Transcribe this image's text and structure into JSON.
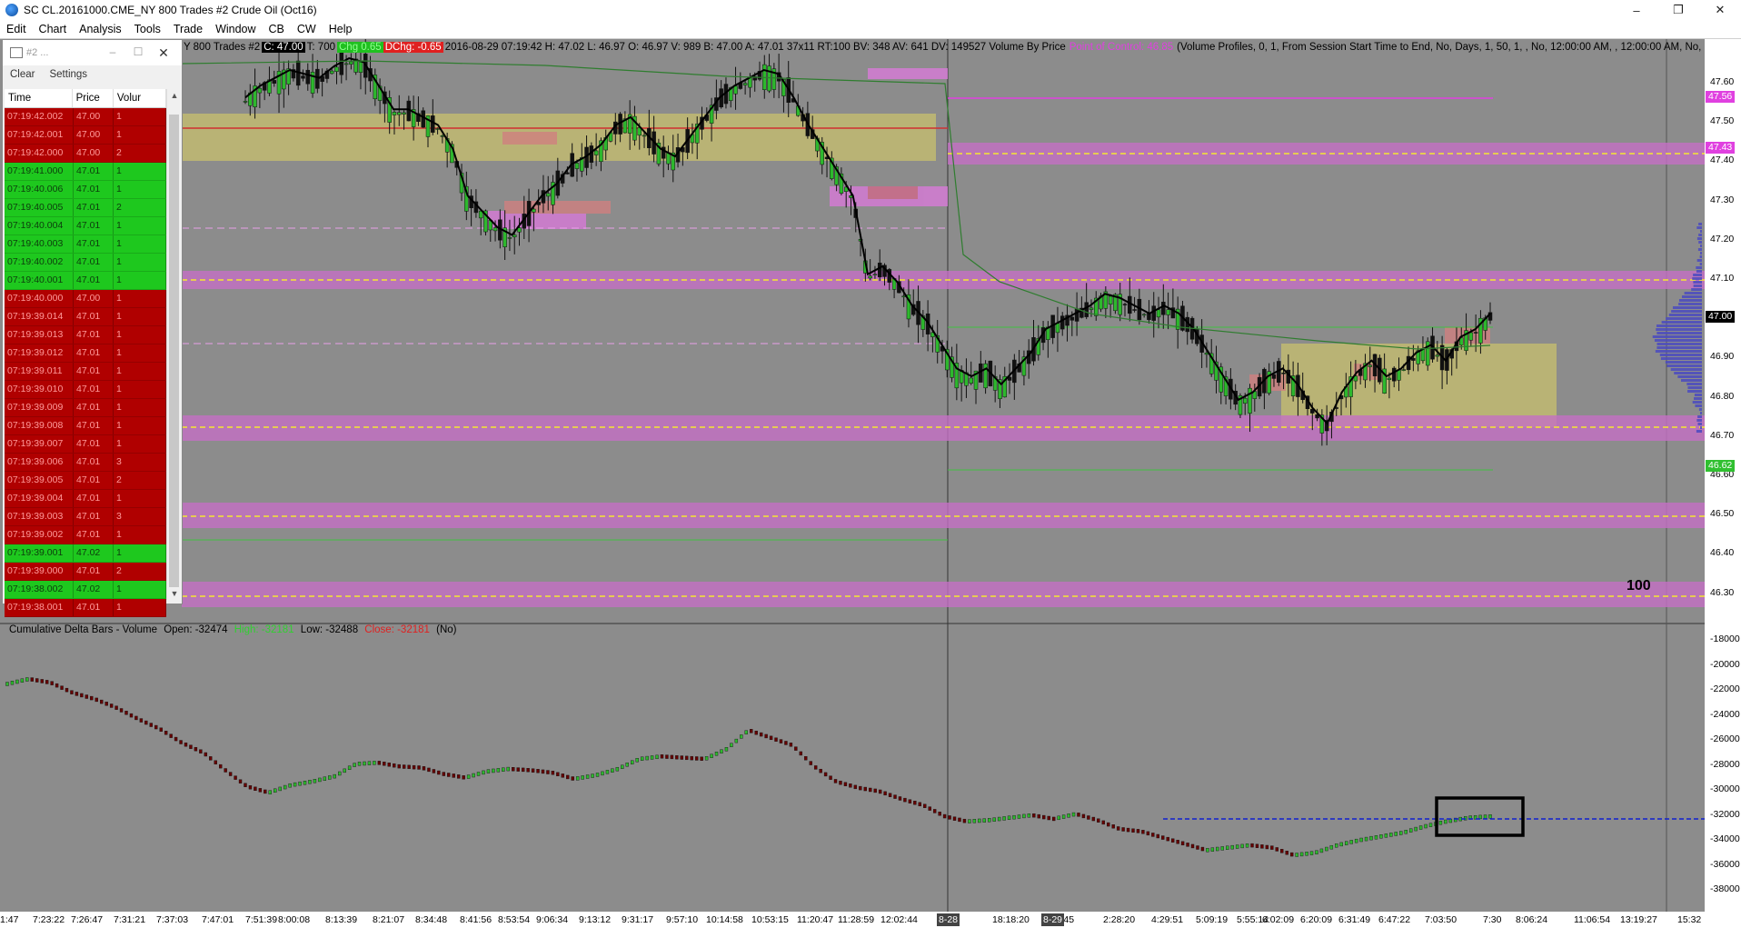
{
  "window": {
    "title": "SC CL.20161000.CME_NY  800 Trades  #2  Crude Oil (Oct16)",
    "controls": [
      "–",
      "❐",
      "✕"
    ]
  },
  "menu": [
    "Edit",
    "Chart",
    "Analysis",
    "Tools",
    "Trade",
    "Window",
    "CB",
    "CW",
    "Help"
  ],
  "chart_info": {
    "prefix": "Y  800 Trades  #2",
    "c_label": "C: 47.00",
    "t_label": "T: 700",
    "chg_label": "Chg 0.65",
    "dchg_label": "DChg: -0.65",
    "ohlc": "2016-08-29 07:19:42 H: 47.02 L: 46.97 O: 46.97 V: 989 B: 47.00 A: 47.01 37x11 RT:100 BV: 348 AV: 641 DV: 149527 Volume By Price",
    "poc": "Point of Control: 46.85",
    "profile": "(Volume Profiles, 0, 1, From Session Start Time to End, No, Days, 1, 50, 1, , No, 12:00:00 AM, , 12:00:00 AM, No, Peri"
  },
  "delta_info": {
    "name": "Cumulative Delta Bars - Volume",
    "open": "Open: -32474",
    "high": "High: -32181",
    "low": "Low: -32488",
    "close": "Close: -32181",
    "extra": "(No)"
  },
  "annotation": "100",
  "ts_panel": {
    "title": "#2 ...",
    "toolbar": [
      "Clear",
      "Settings"
    ],
    "columns": [
      "Time",
      "Price",
      "Volur"
    ],
    "rows": [
      {
        "time": "07:19:42.002",
        "price": "47.00",
        "vol": "1",
        "side": "down"
      },
      {
        "time": "07:19:42.001",
        "price": "47.00",
        "vol": "1",
        "side": "down"
      },
      {
        "time": "07:19:42.000",
        "price": "47.00",
        "vol": "2",
        "side": "down"
      },
      {
        "time": "07:19:41.000",
        "price": "47.01",
        "vol": "1",
        "side": "up"
      },
      {
        "time": "07:19:40.006",
        "price": "47.01",
        "vol": "1",
        "side": "up"
      },
      {
        "time": "07:19:40.005",
        "price": "47.01",
        "vol": "2",
        "side": "up"
      },
      {
        "time": "07:19:40.004",
        "price": "47.01",
        "vol": "1",
        "side": "up"
      },
      {
        "time": "07:19:40.003",
        "price": "47.01",
        "vol": "1",
        "side": "up"
      },
      {
        "time": "07:19:40.002",
        "price": "47.01",
        "vol": "1",
        "side": "up"
      },
      {
        "time": "07:19:40.001",
        "price": "47.01",
        "vol": "1",
        "side": "up"
      },
      {
        "time": "07:19:40.000",
        "price": "47.00",
        "vol": "1",
        "side": "down"
      },
      {
        "time": "07:19:39.014",
        "price": "47.01",
        "vol": "1",
        "side": "down"
      },
      {
        "time": "07:19:39.013",
        "price": "47.01",
        "vol": "1",
        "side": "down"
      },
      {
        "time": "07:19:39.012",
        "price": "47.01",
        "vol": "1",
        "side": "down"
      },
      {
        "time": "07:19:39.011",
        "price": "47.01",
        "vol": "1",
        "side": "down"
      },
      {
        "time": "07:19:39.010",
        "price": "47.01",
        "vol": "1",
        "side": "down"
      },
      {
        "time": "07:19:39.009",
        "price": "47.01",
        "vol": "1",
        "side": "down"
      },
      {
        "time": "07:19:39.008",
        "price": "47.01",
        "vol": "1",
        "side": "down"
      },
      {
        "time": "07:19:39.007",
        "price": "47.01",
        "vol": "1",
        "side": "down"
      },
      {
        "time": "07:19:39.006",
        "price": "47.01",
        "vol": "3",
        "side": "down"
      },
      {
        "time": "07:19:39.005",
        "price": "47.01",
        "vol": "2",
        "side": "down"
      },
      {
        "time": "07:19:39.004",
        "price": "47.01",
        "vol": "1",
        "side": "down"
      },
      {
        "time": "07:19:39.003",
        "price": "47.01",
        "vol": "3",
        "side": "down"
      },
      {
        "time": "07:19:39.002",
        "price": "47.01",
        "vol": "1",
        "side": "down"
      },
      {
        "time": "07:19:39.001",
        "price": "47.02",
        "vol": "1",
        "side": "up"
      },
      {
        "time": "07:19:39.000",
        "price": "47.01",
        "vol": "2",
        "side": "down"
      },
      {
        "time": "07:19:38.002",
        "price": "47.02",
        "vol": "1",
        "side": "up"
      },
      {
        "time": "07:19:38.001",
        "price": "47.01",
        "vol": "1",
        "side": "down"
      }
    ]
  },
  "price_axis": {
    "ticks": [
      "47.60",
      "47.50",
      "47.40",
      "47.30",
      "47.20",
      "47.10",
      "47.00",
      "46.90",
      "46.80",
      "46.70",
      "46.60",
      "46.50",
      "46.40",
      "46.30"
    ],
    "tags": [
      {
        "label": "47.56",
        "color": "#e040e0",
        "text_color": "#fff"
      },
      {
        "label": "47.43",
        "color": "#e040e0",
        "text_color": "#fff"
      },
      {
        "label": "47.00",
        "color": "#000",
        "text_color": "#fff"
      },
      {
        "label": "46.62",
        "color": "#30c030",
        "text_color": "#fff"
      }
    ]
  },
  "delta_axis": {
    "ticks": [
      "-18000",
      "-20000",
      "-22000",
      "-24000",
      "-26000",
      "-28000",
      "-30000",
      "-32000",
      "-34000",
      "-36000",
      "-38000"
    ]
  },
  "time_axis": {
    "labels": [
      "1:47",
      "7:23:22",
      "7:26:47",
      "7:31:21",
      "7:37:03",
      "7:47:01",
      "7:51:39",
      "8:00:08",
      "8:13:39",
      "8:21:07",
      "8:34:48",
      "8:41:56",
      "8:53:54",
      "9:06:34",
      "9:13:12",
      "9:31:17",
      "9:57:10",
      "10:14:58",
      "10:53:15",
      "11:20:47",
      "11:28:59",
      "12:02:44",
      "18:18:20",
      "1:04:45",
      "2:28:20",
      "4:29:51",
      "5:09:19",
      "5:55:14",
      "6:02:09",
      "6:20:09",
      "6:31:49",
      "6:47:22",
      "7:03:50",
      "7:30",
      "8:06:24",
      "11:06:54",
      "13:19:27",
      "15:32"
    ],
    "tags": [
      "8-28",
      "8-29"
    ]
  },
  "chart_data": {
    "type": "candlestick",
    "price_ylim": [
      46.25,
      47.66
    ],
    "delta_ylim": [
      -38000,
      -17500
    ],
    "close_path": [
      47.55,
      47.58,
      47.6,
      47.62,
      47.61,
      47.6,
      47.63,
      47.65,
      47.64,
      47.58,
      47.52,
      47.52,
      47.5,
      47.48,
      47.42,
      47.3,
      47.26,
      47.22,
      47.2,
      47.25,
      47.3,
      47.33,
      47.38,
      47.4,
      47.43,
      47.48,
      47.5,
      47.46,
      47.42,
      47.4,
      47.45,
      47.5,
      47.55,
      47.58,
      47.6,
      47.62,
      47.61,
      47.55,
      47.48,
      47.42,
      47.36,
      47.3,
      47.1,
      47.12,
      47.08,
      47.02,
      46.98,
      46.92,
      46.86,
      46.84,
      46.86,
      46.82,
      46.86,
      46.9,
      46.96,
      46.98,
      47.0,
      47.02,
      47.05,
      47.04,
      47.02,
      47.0,
      47.02,
      47.0,
      46.96,
      46.9,
      46.84,
      46.78,
      46.8,
      46.84,
      46.86,
      46.82,
      46.76,
      46.72,
      46.8,
      46.85,
      46.88,
      46.84,
      46.86,
      46.9,
      46.92,
      46.88,
      46.94,
      46.96,
      47.0
    ],
    "delta_path": [
      -21600,
      -21200,
      -21500,
      -22300,
      -22800,
      -23500,
      -24400,
      -25200,
      -26300,
      -27100,
      -28500,
      -29800,
      -30300,
      -29700,
      -29400,
      -29000,
      -28000,
      -27900,
      -28200,
      -28300,
      -28800,
      -29100,
      -28600,
      -28400,
      -28500,
      -28700,
      -29200,
      -28900,
      -28400,
      -27600,
      -27400,
      -27500,
      -27600,
      -26800,
      -25300,
      -25900,
      -26500,
      -28200,
      -29400,
      -29900,
      -30200,
      -30800,
      -31300,
      -32200,
      -32600,
      -32500,
      -32300,
      -32100,
      -32400,
      -32000,
      -32500,
      -33200,
      -33400,
      -33900,
      -34400,
      -34900,
      -34700,
      -34500,
      -34700,
      -35300,
      -35100,
      -34500,
      -34100,
      -33800,
      -33500,
      -33000,
      -32600,
      -32300,
      -32200
    ]
  }
}
